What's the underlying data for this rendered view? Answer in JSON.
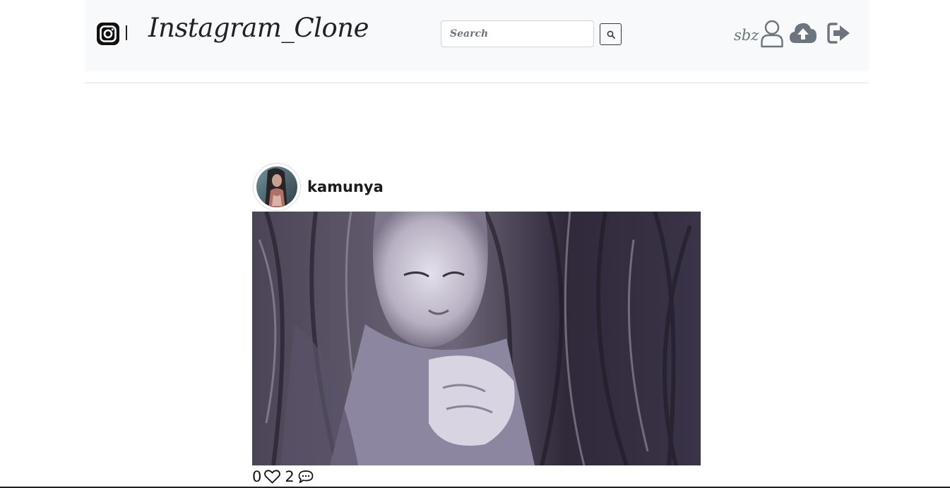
{
  "navbar": {
    "brand_title": "Instagram_Clone",
    "brand_icon": "instagram-icon",
    "search": {
      "placeholder": "Search",
      "value": "",
      "button_icon": "search-icon"
    },
    "user": {
      "name": "sbz",
      "icon": "user-icon"
    },
    "upload_icon": "cloud-upload-icon",
    "logout_icon": "sign-out-icon"
  },
  "post": {
    "username": "kamunya",
    "likes": "0",
    "comments": "2",
    "like_icon": "heart-icon",
    "comment_icon": "comment-icon"
  },
  "colors": {
    "navbar_bg": "#f8f9fa",
    "text_dark": "#222222",
    "icon_gray": "#6c757d"
  }
}
